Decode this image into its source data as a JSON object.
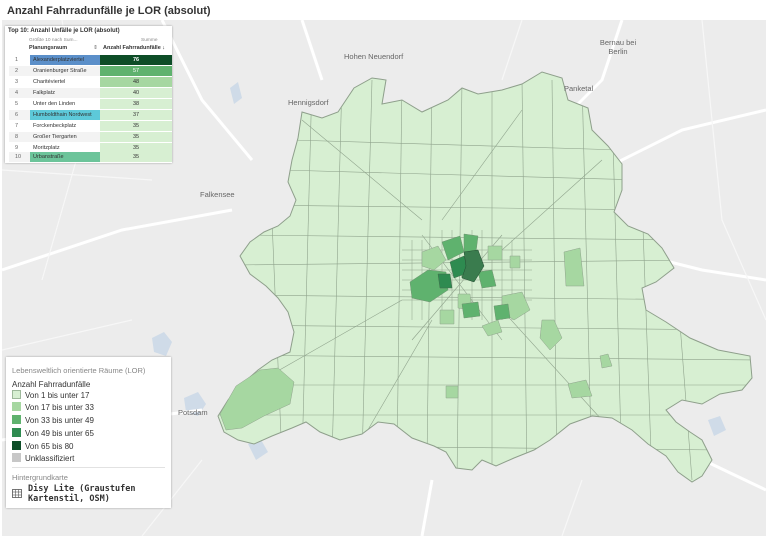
{
  "page_title": "Anzahl Fahrradunfälle je LOR (absolut)",
  "colors": {
    "class1": "#d7efd2",
    "class2": "#a6d7a1",
    "class3": "#5fb26e",
    "class4": "#2e8b50",
    "class5": "#0d4d27",
    "unclassified": "#c7c7c7",
    "highlight_blue": "#5b8fc9",
    "highlight_cyan": "#5dc9d9",
    "highlight_teal": "#6cc49a"
  },
  "places": {
    "hohen_neuendorf": "Hohen Neuendorf",
    "bernau": "Bernau bei Berlin",
    "hennigsdorf": "Hennigsdorf",
    "panketal": "Panketal",
    "falkensee": "Falkensee",
    "potsdam": "Potsdam"
  },
  "top10": {
    "title": "Top 10: Anzahl Unfälle je LOR (absolut)",
    "sub_left": "Größte 10 nach Sum...",
    "sub_right": "Summe",
    "col_name": "Planungsraum",
    "col_value": "Anzahl Fahrradunfälle",
    "rows": [
      {
        "rank": "1",
        "name": "Alexanderplatzviertel",
        "value": "76"
      },
      {
        "rank": "2",
        "name": "Oranienburger Straße",
        "value": "57"
      },
      {
        "rank": "3",
        "name": "Charitéviertel",
        "value": "48"
      },
      {
        "rank": "4",
        "name": "Falkplatz",
        "value": "40"
      },
      {
        "rank": "5",
        "name": "Unter den Linden",
        "value": "38"
      },
      {
        "rank": "6",
        "name": "Humboldthain Nordwest",
        "value": "37"
      },
      {
        "rank": "7",
        "name": "Forckenbeckplatz",
        "value": "35"
      },
      {
        "rank": "8",
        "name": "Großer Tiergarten",
        "value": "35"
      },
      {
        "rank": "9",
        "name": "Moritzplatz",
        "value": "35"
      },
      {
        "rank": "10",
        "name": "Urbanstraße",
        "value": "35"
      }
    ]
  },
  "legend": {
    "section_title": "Lebensweltlich orientierte Räume (LOR)",
    "title": "Anzahl Fahrradunfälle",
    "items": [
      "Von 1 bis unter 17",
      "Von 17 bis unter 33",
      "Von 33 bis unter 49",
      "Von 49 bis unter 65",
      "Von 65 bis 80",
      "Unklassifiziert"
    ],
    "background_title": "Hintergrundkarte",
    "background_name": "Disy Lite (Graustufen Kartenstil, OSM)"
  }
}
